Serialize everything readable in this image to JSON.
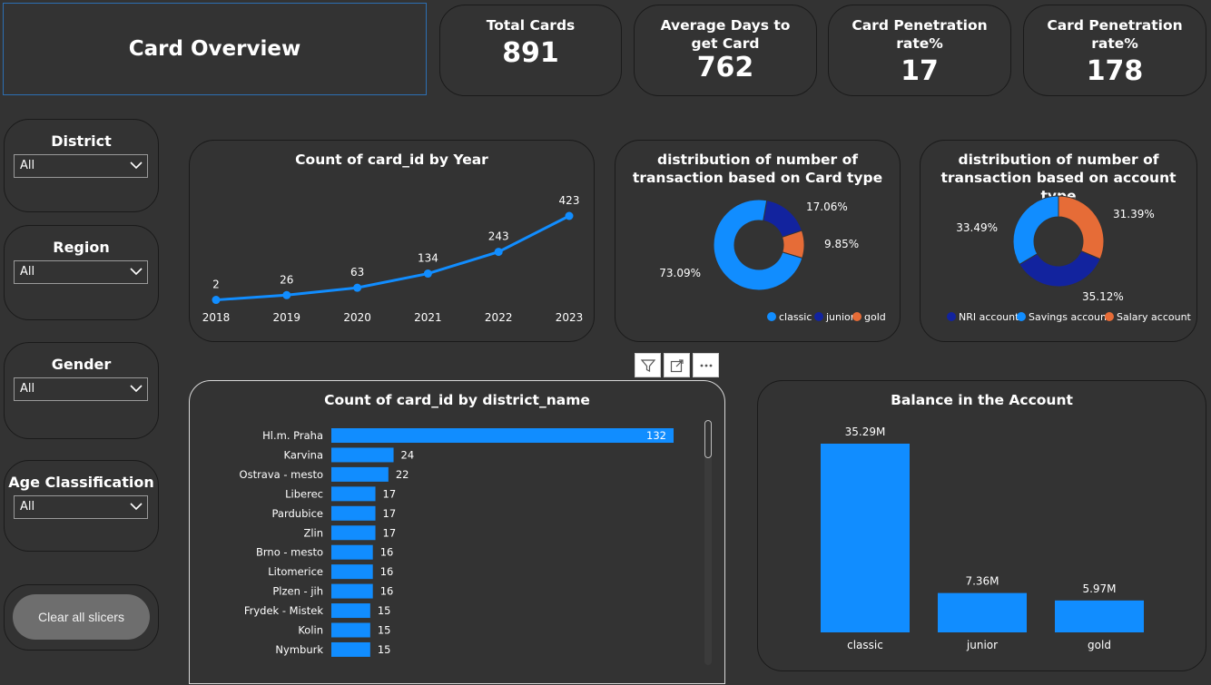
{
  "header": {
    "title": "Card Overview"
  },
  "kpis": [
    {
      "label": "Total Cards",
      "value": "891"
    },
    {
      "label": "Average Days to get Card",
      "value": "762"
    },
    {
      "label": "Card Penetration rate%",
      "value": "17"
    },
    {
      "label": "Card Penetration rate%",
      "value": "178"
    }
  ],
  "slicers": [
    {
      "label": "District",
      "value": "All"
    },
    {
      "label": "Region",
      "value": "All"
    },
    {
      "label": "Gender",
      "value": "All"
    },
    {
      "label": "Age Classification",
      "value": "All"
    }
  ],
  "clear_button": "Clear all slicers",
  "colors": {
    "blue": "#118dff",
    "navy": "#12239e",
    "orange": "#e66c37",
    "background": "#333333"
  },
  "chart_data": [
    {
      "type": "line",
      "title": "Count of card_id by Year",
      "x": [
        "2018",
        "2019",
        "2020",
        "2021",
        "2022",
        "2023"
      ],
      "values": [
        2,
        26,
        63,
        134,
        243,
        423
      ],
      "data_labels": [
        "2",
        "26",
        "63",
        "134",
        "243",
        "423"
      ]
    },
    {
      "type": "pie",
      "title": "distribution of number of transaction based on Card type",
      "slices": [
        {
          "name": "classic",
          "value": 73.09,
          "label": "73.09%",
          "color": "#118dff"
        },
        {
          "name": "junior",
          "value": 17.06,
          "label": "17.06%",
          "color": "#12239e"
        },
        {
          "name": "gold",
          "value": 9.85,
          "label": "9.85%",
          "color": "#e66c37"
        }
      ],
      "legend": [
        "classic",
        "junior",
        "gold"
      ],
      "legend_position": "bottom-right"
    },
    {
      "type": "pie",
      "title": "distribution of number of transaction based on account type",
      "slices": [
        {
          "name": "Salary account",
          "value": 31.39,
          "label": "31.39%",
          "color": "#e66c37"
        },
        {
          "name": "NRI account",
          "value": 35.12,
          "label": "35.12%",
          "color": "#12239e"
        },
        {
          "name": "Savings account",
          "value": 33.49,
          "label": "33.49%",
          "color": "#118dff"
        }
      ],
      "legend": [
        "NRI account",
        "Savings account",
        "Salary account"
      ],
      "legend_position": "bottom"
    },
    {
      "type": "bar",
      "orientation": "horizontal",
      "title": "Count of card_id by district_name",
      "categories": [
        "Hl.m. Praha",
        "Karvina",
        "Ostrava - mesto",
        "Liberec",
        "Pardubice",
        "Zlin",
        "Brno - mesto",
        "Litomerice",
        "Plzen - jih",
        "Frydek - Mistek",
        "Kolin",
        "Nymburk"
      ],
      "values": [
        132,
        24,
        22,
        17,
        17,
        17,
        16,
        16,
        16,
        15,
        15,
        15
      ],
      "xlim": [
        0,
        132
      ]
    },
    {
      "type": "bar",
      "title": "Balance in the Account",
      "categories": [
        "classic",
        "junior",
        "gold"
      ],
      "values": [
        35.29,
        7.36,
        5.97
      ],
      "data_labels": [
        "35.29M",
        "7.36M",
        "5.97M"
      ],
      "unit": "M",
      "ylim": [
        0,
        35.29
      ]
    }
  ]
}
